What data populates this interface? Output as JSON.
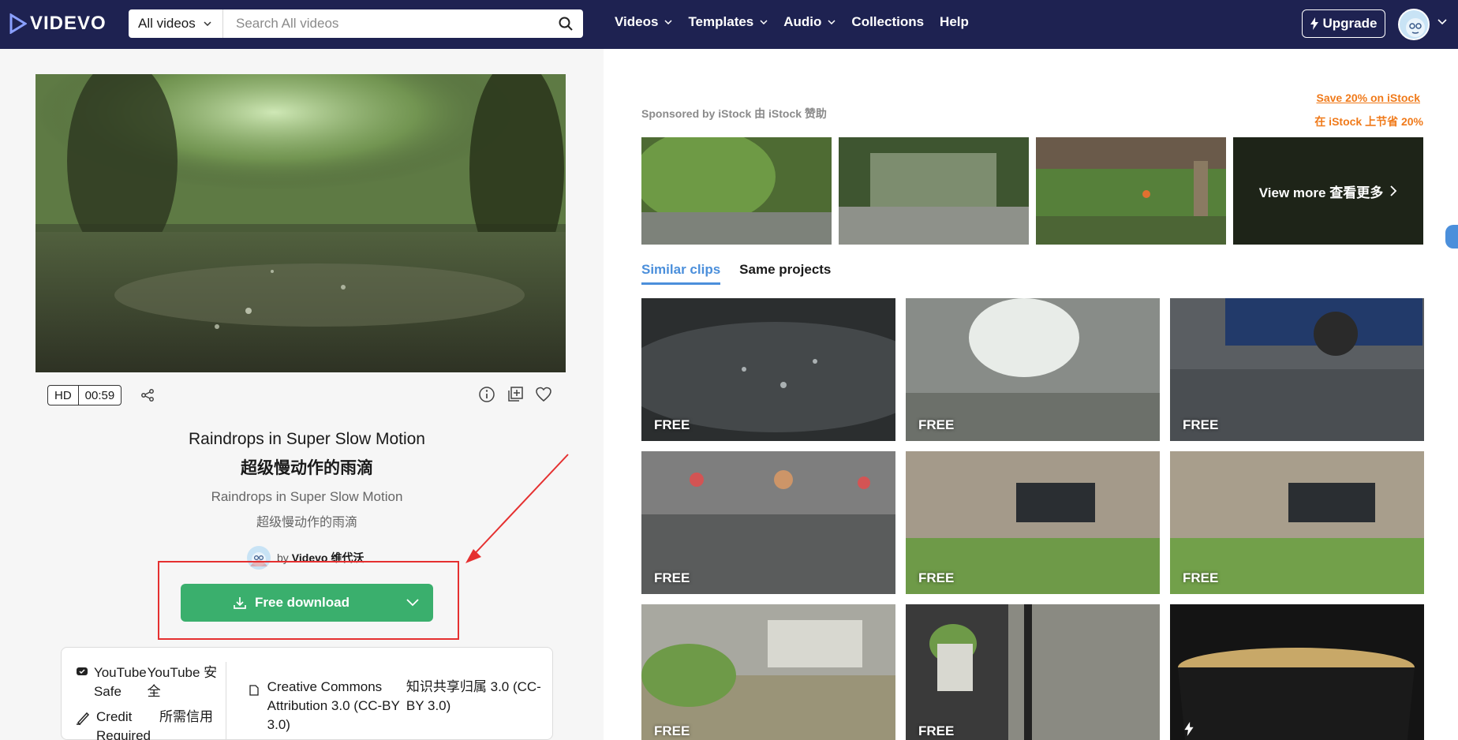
{
  "header": {
    "logo": "VIDEVO",
    "search_category": "All videos",
    "search_placeholder": "Search All videos",
    "nav": [
      {
        "label": "Videos",
        "has_dropdown": true
      },
      {
        "label": "Templates",
        "has_dropdown": true
      },
      {
        "label": "Audio",
        "has_dropdown": true
      },
      {
        "label": "Collections",
        "has_dropdown": false
      },
      {
        "label": "Help",
        "has_dropdown": false
      }
    ],
    "upgrade_label": "Upgrade"
  },
  "video": {
    "quality": "HD",
    "duration": "00:59",
    "title_en": "Raindrops in Super Slow Motion",
    "title_zh": "超级慢动作的雨滴",
    "desc_en": "Raindrops in Super Slow Motion",
    "desc_zh": "超级慢动作的雨滴",
    "author_prefix": "by",
    "author_name": "Videvo 维代沃",
    "download_label": "Free download"
  },
  "license": {
    "youtube_safe_en": "YouTube Safe",
    "youtube_safe_zh": "YouTube 安全",
    "credit_en": "Credit Required",
    "credit_zh": "所需信用",
    "cc_en": "Creative Commons Attribution 3.0 (CC-BY 3.0)",
    "cc_zh": "知识共享归属 3.0 (CC-BY 3.0)"
  },
  "sponsor": {
    "label": "Sponsored by iStock 由 iStock 赞助",
    "save_en": "Save 20% on iStock",
    "save_zh": "在 iStock 上节省 20%",
    "view_more": "View more 查看更多"
  },
  "tabs": [
    {
      "label": "Similar clips",
      "active": true
    },
    {
      "label": "Same projects",
      "active": false
    }
  ],
  "clips": [
    {
      "badge": "FREE"
    },
    {
      "badge": "FREE"
    },
    {
      "badge": "FREE"
    },
    {
      "badge": "FREE"
    },
    {
      "badge": "FREE"
    },
    {
      "badge": "FREE"
    },
    {
      "badge": "FREE"
    },
    {
      "badge": "FREE"
    },
    {
      "badge": ""
    }
  ],
  "colors": {
    "nav_bg": "#1e2251",
    "download_green": "#3aaf6d",
    "accent_blue": "#4b8fdb",
    "istock_orange": "#f07a1a",
    "annotation_red": "#e53030"
  }
}
